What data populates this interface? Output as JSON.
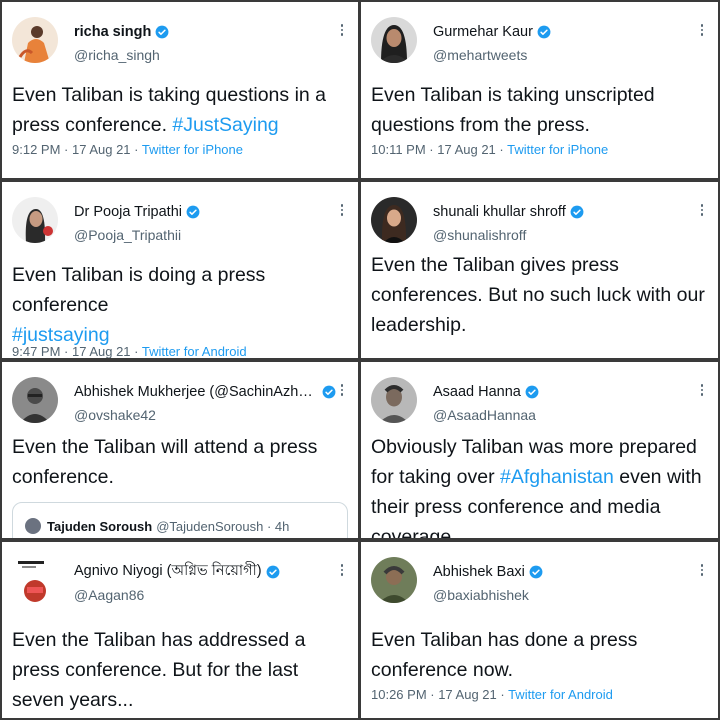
{
  "tweets": [
    {
      "name": "richa singh",
      "handle": "@richa_singh",
      "text": "Even Taliban is taking questions in a press conference. ",
      "hashtag": "#JustSaying",
      "time": "9:12 PM · 17 Aug 21 · ",
      "source": "Twitter for iPhone",
      "avatar_icon": "person-photo-avatar"
    },
    {
      "name": "Gurmehar Kaur",
      "handle": "@mehartweets",
      "text": "Even Taliban is taking unscripted questions from the press.",
      "time": "10:11 PM · 17 Aug 21 · ",
      "source": "Twitter for iPhone",
      "avatar_icon": "person-photo-avatar"
    },
    {
      "name": "Dr Pooja Tripathi",
      "handle": "@Pooja_Tripathii",
      "text": "Even Taliban is doing a press conference",
      "hashtag": "#justsaying",
      "time": "9:47 PM · 17 Aug 21 · ",
      "source": "Twitter for Android",
      "avatar_icon": "person-photo-avatar"
    },
    {
      "name": "shunali khullar shroff",
      "handle": "@shunalishroff",
      "text": "Even the Taliban gives press conferences. But no such luck with our leadership.",
      "avatar_icon": "person-photo-avatar"
    },
    {
      "name": "Abhishek Mukherjee (@SachinAzhar...",
      "handle": "@ovshake42",
      "text": "Even the Taliban will attend a press conference.",
      "quote": {
        "name": "Tajuden Soroush",
        "handle": "@TajudenSoroush · 4h"
      },
      "avatar_icon": "person-photo-avatar"
    },
    {
      "name": "Asaad Hanna",
      "handle": "@AsaadHannaa",
      "text_before": "Obviously Taliban was more prepared for taking over ",
      "hashtag": "#Afghanistan",
      "text_after": " even with their press conference and media coverage",
      "avatar_icon": "person-photo-avatar"
    },
    {
      "name": "Agnivo Niyogi (অগ্নিভ নিয়োগী)",
      "handle": "@Aagan86",
      "text": "Even the Taliban has addressed a press conference. But for the last seven years...",
      "avatar_icon": "newspaper-logo-avatar"
    },
    {
      "name": "Abhishek Baxi",
      "handle": "@baxiabhishek",
      "text": "Even Taliban has done a press conference now.",
      "time": "10:26 PM · 17 Aug 21 · ",
      "source": "Twitter for Android",
      "avatar_icon": "person-photo-avatar"
    }
  ],
  "colors": {
    "link": "#1d9bf0",
    "muted": "#536471",
    "text": "#0f1419",
    "divider": "#3a3a3a"
  }
}
